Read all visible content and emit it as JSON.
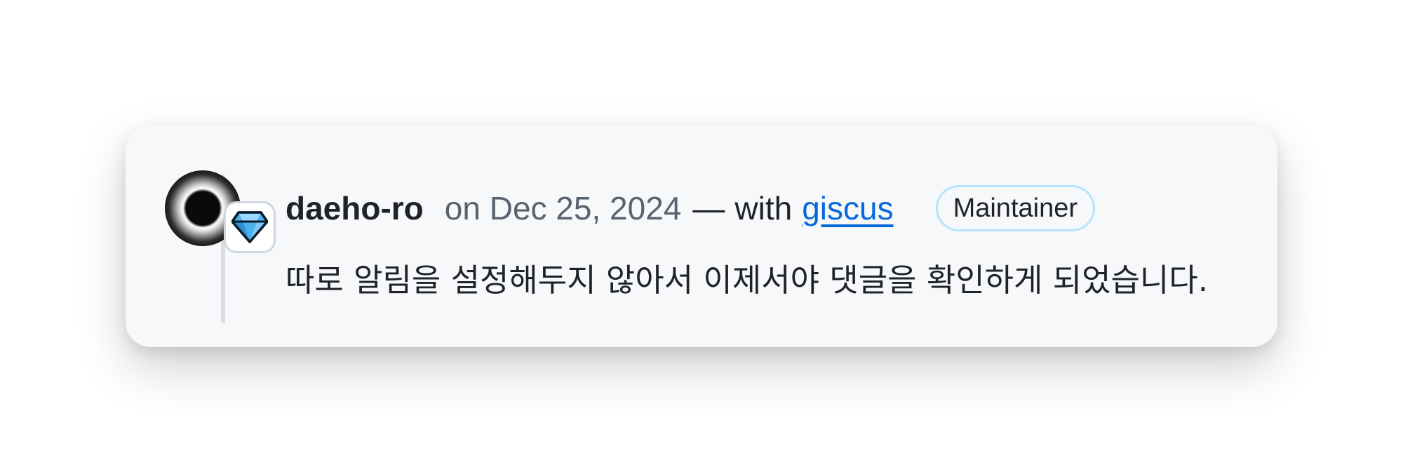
{
  "comment": {
    "author": "daeho-ro",
    "date": "on Dec 25, 2024",
    "separator": "—",
    "with_text": "with",
    "via_link": "giscus",
    "role_badge": "Maintainer",
    "avatar_icon": "eclipse-avatar",
    "status_icon": "gem-icon",
    "body": "따로 알림을 설정해두지 않아서 이제서야 댓글을 확인하게 되었습니다."
  },
  "colors": {
    "card_background": "#f6f8fa",
    "link": "#0969da",
    "muted_text": "#59636e",
    "badge_border": "#b6e3ff",
    "gem_fill": "#4cb0ee"
  }
}
